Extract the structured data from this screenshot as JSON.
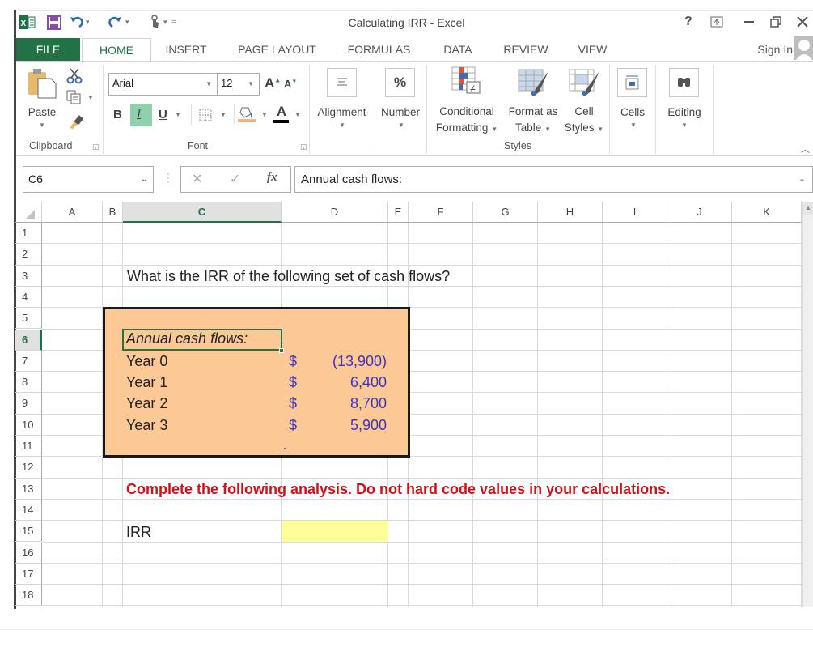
{
  "window": {
    "title": "Calculating IRR - Excel",
    "help_label": "?",
    "sign_in_label": "Sign In"
  },
  "quick_access": {
    "icons": [
      "excel-logo-icon",
      "save-icon",
      "undo-icon",
      "redo-icon",
      "touch-mode-icon",
      "customize-icon"
    ]
  },
  "tabs": [
    {
      "label": "FILE",
      "active": false
    },
    {
      "label": "HOME",
      "active": true
    },
    {
      "label": "INSERT",
      "active": false
    },
    {
      "label": "PAGE LAYOUT",
      "active": false
    },
    {
      "label": "FORMULAS",
      "active": false
    },
    {
      "label": "DATA",
      "active": false
    },
    {
      "label": "REVIEW",
      "active": false
    },
    {
      "label": "VIEW",
      "active": false
    }
  ],
  "ribbon": {
    "clipboard": {
      "paste_label": "Paste",
      "group_label": "Clipboard"
    },
    "font": {
      "font_name": "Arial",
      "font_size": "12",
      "bold_label": "B",
      "italic_label": "I",
      "underline_label": "U",
      "italic_active": true,
      "font_color_label": "A",
      "group_label": "Font"
    },
    "alignment_label": "Alignment",
    "number_label": "Number",
    "number_icon_label": "%",
    "conditional_formatting": [
      "Conditional",
      "Formatting"
    ],
    "format_as_table": [
      "Format as",
      "Table"
    ],
    "cell_styles": [
      "Cell",
      "Styles"
    ],
    "styles_group_label": "Styles",
    "cells_label": "Cells",
    "editing_label": "Editing"
  },
  "formula_bar": {
    "name_box": "C6",
    "fx_label": "fx",
    "content": "Annual cash flows:"
  },
  "sheet": {
    "columns": [
      "A",
      "B",
      "C",
      "D",
      "E",
      "F",
      "G",
      "H",
      "I",
      "J",
      "K"
    ],
    "selected_column": "C",
    "rows": [
      "1",
      "2",
      "3",
      "4",
      "5",
      "6",
      "7",
      "8",
      "9",
      "10",
      "11",
      "12",
      "13",
      "14",
      "15",
      "16",
      "17",
      "18"
    ],
    "selected_row": "6",
    "selected_cell": "C6",
    "question": "What is the IRR of the following set of cash flows?",
    "cash_flow_header": "Annual cash flows:",
    "cash_flows": [
      {
        "label": "Year 0",
        "currency": "$",
        "value": "(13,900)"
      },
      {
        "label": "Year 1",
        "currency": "$",
        "value": "6,400"
      },
      {
        "label": "Year 2",
        "currency": "$",
        "value": "8,700"
      },
      {
        "label": "Year 3",
        "currency": "$",
        "value": "5,900"
      }
    ],
    "instruction": "Complete the following analysis. Do not hard code values in your calculations.",
    "irr_label": "IRR",
    "irr_value": "",
    "colors": {
      "box_fill": "#fcc896",
      "input_fill": "#ffff99",
      "instruction": "#d0121b",
      "values": "#3b33c4",
      "accent": "#217346"
    }
  }
}
